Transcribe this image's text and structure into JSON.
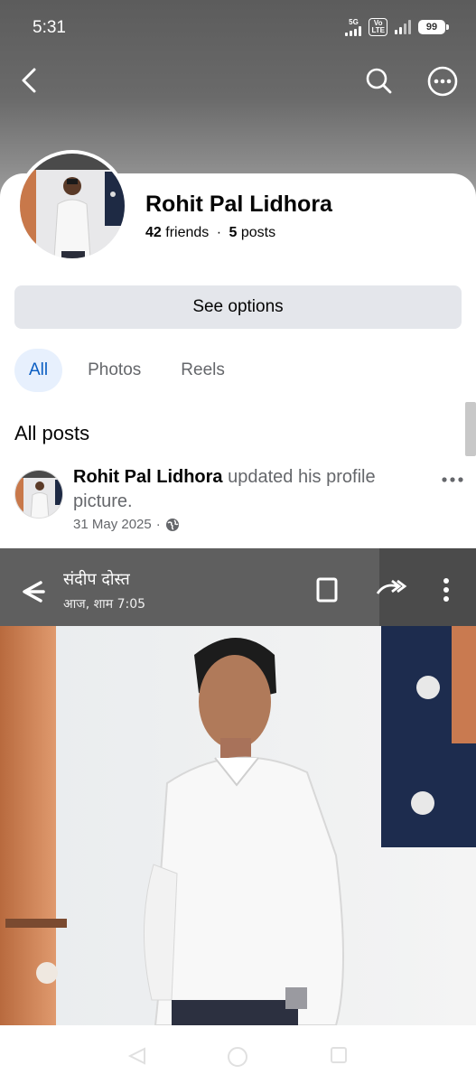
{
  "status_bar": {
    "time": "5:31",
    "network_label": "5G",
    "volte_label_top": "Vo",
    "volte_label_bottom": "LTE",
    "battery": "99"
  },
  "header": {
    "back_icon": "chevron-left-icon",
    "search_icon": "search-icon",
    "more_icon": "more-circle-icon"
  },
  "profile": {
    "name": "Rohit Pal Lidhora",
    "friends_count": "42",
    "friends_label": "friends",
    "separator": "·",
    "posts_count": "5",
    "posts_label": "posts",
    "options_button": "See options"
  },
  "tabs": [
    {
      "label": "All",
      "active": true
    },
    {
      "label": "Photos",
      "active": false
    },
    {
      "label": "Reels",
      "active": false
    }
  ],
  "section_title": "All posts",
  "post": {
    "author": "Rohit Pal Lidhora",
    "action": "updated his profile picture.",
    "date": "31 May 2025",
    "date_separator": "·",
    "privacy_icon": "globe-icon",
    "image": {
      "contact_name": "संदीप दोस्त",
      "subtitle": "आज, शाम 7:05"
    }
  },
  "colors": {
    "accent": "#0a5dc2",
    "tab_active_bg": "#e7f0fd",
    "button_bg": "#e4e6eb",
    "muted_text": "#65676b"
  }
}
